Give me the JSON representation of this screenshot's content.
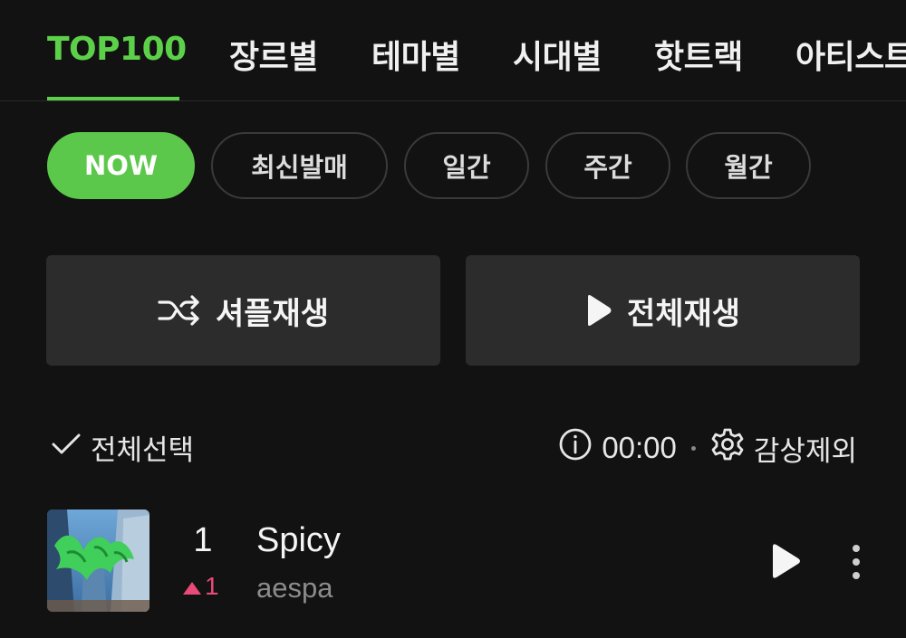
{
  "tabs": [
    {
      "label": "TOP100"
    },
    {
      "label": "장르별"
    },
    {
      "label": "테마별"
    },
    {
      "label": "시대별"
    },
    {
      "label": "핫트랙"
    },
    {
      "label": "아티스트"
    }
  ],
  "filters": [
    {
      "label": "NOW"
    },
    {
      "label": "최신발매"
    },
    {
      "label": "일간"
    },
    {
      "label": "주간"
    },
    {
      "label": "월간"
    }
  ],
  "actions": {
    "shuffle_label": "셔플재생",
    "play_all_label": "전체재생"
  },
  "toolbar": {
    "select_all_label": "전체선택",
    "time": "00:00",
    "exclude_label": "감상제외"
  },
  "songs": [
    {
      "rank": "1",
      "rank_change": "1",
      "title": "Spicy",
      "artist": "aespa"
    }
  ],
  "icons": {
    "check": "check-icon",
    "info": "info-icon",
    "settings": "gear-icon",
    "shuffle": "shuffle-icon",
    "play": "play-icon",
    "more": "more-vertical-icon",
    "rank_up": "triangle-up-icon"
  },
  "colors": {
    "accent": "#5dd04a",
    "rank_up": "#e84a7a",
    "background": "#121212",
    "button_bg": "#2c2c2c"
  }
}
